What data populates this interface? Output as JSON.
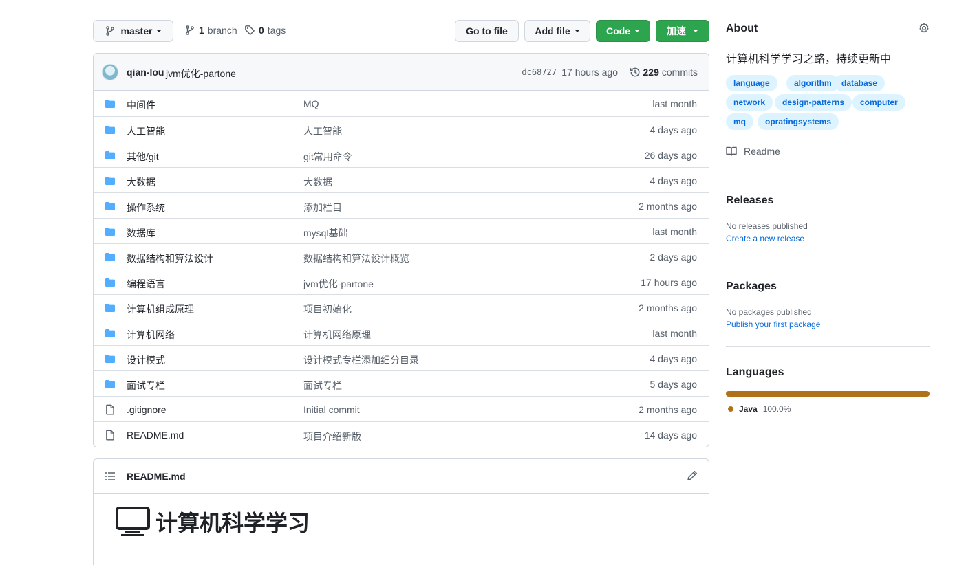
{
  "toolbar": {
    "branch_name": "master",
    "branch_count": "1",
    "branch_label": "branch",
    "tag_count": "0",
    "tag_label": "tags",
    "goto_file": "Go to file",
    "add_file": "Add file",
    "code": "Code",
    "speed": "加速"
  },
  "commit": {
    "author": "qian-lou",
    "message": "jvm优化-partone",
    "sha": "dc68727",
    "time": "17 hours ago",
    "count": "229",
    "count_label": "commits"
  },
  "files": [
    {
      "name": "中间件",
      "message": "MQ",
      "time": "last month",
      "type": "dir"
    },
    {
      "name": "人工智能",
      "message": "人工智能",
      "time": "4 days ago",
      "type": "dir"
    },
    {
      "name": "其他/git",
      "message": "git常用命令",
      "time": "26 days ago",
      "type": "dir"
    },
    {
      "name": "大数据",
      "message": "大数据",
      "time": "4 days ago",
      "type": "dir"
    },
    {
      "name": "操作系统",
      "message": "添加栏目",
      "time": "2 months ago",
      "type": "dir"
    },
    {
      "name": "数据库",
      "message": "mysql基础",
      "time": "last month",
      "type": "dir"
    },
    {
      "name": "数据结构和算法设计",
      "message": "数据结构和算法设计概览",
      "time": "2 days ago",
      "type": "dir"
    },
    {
      "name": "编程语言",
      "message": "jvm优化-partone",
      "time": "17 hours ago",
      "type": "dir"
    },
    {
      "name": "计算机组成原理",
      "message": "项目初始化",
      "time": "2 months ago",
      "type": "dir"
    },
    {
      "name": "计算机网络",
      "message": "计算机网络原理",
      "time": "last month",
      "type": "dir"
    },
    {
      "name": "设计模式",
      "message": "设计模式专栏添加细分目录",
      "time": "4 days ago",
      "type": "dir"
    },
    {
      "name": "面试专栏",
      "message": "面试专栏",
      "time": "5 days ago",
      "type": "dir"
    },
    {
      "name": ".gitignore",
      "message": "Initial commit",
      "time": "2 months ago",
      "type": "file"
    },
    {
      "name": "README.md",
      "message": "项目介绍新版",
      "time": "14 days ago",
      "type": "file"
    }
  ],
  "readme": {
    "title": "README.md",
    "heading": "计算机科学学习"
  },
  "about": {
    "title": "About",
    "description": "计算机科学学习之路，持续更新中",
    "topics": [
      "language",
      "algorithm",
      "database",
      "network",
      "design-patterns",
      "computer",
      "mq",
      "opratingsystems"
    ],
    "readme_link": "Readme"
  },
  "releases": {
    "title": "Releases",
    "empty": "No releases published",
    "link": "Create a new release"
  },
  "packages": {
    "title": "Packages",
    "empty": "No packages published",
    "link": "Publish your first package"
  },
  "languages": {
    "title": "Languages",
    "items": [
      {
        "name": "Java",
        "percent": "100.0%",
        "color": "#b07219"
      }
    ]
  },
  "colors": {
    "accent_green": "#2da44e",
    "folder_blue": "#54aeff",
    "link_blue": "#0969da"
  }
}
